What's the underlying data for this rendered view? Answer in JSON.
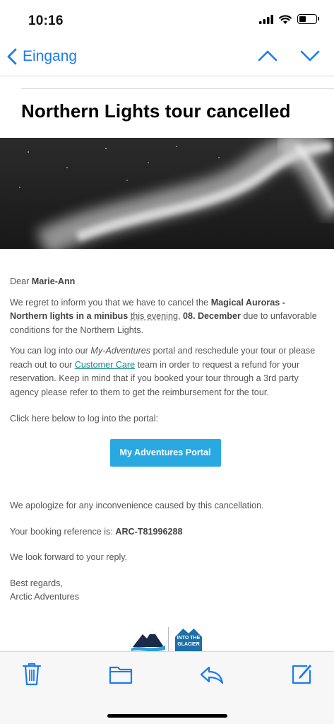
{
  "status_bar": {
    "time": "10:16"
  },
  "nav": {
    "back_label": "Eingang"
  },
  "email": {
    "subject": "Northern Lights tour cancelled",
    "greeting_prefix": "Dear ",
    "recipient_name": "Marie-Ann",
    "p1_a": "We regret to inform you that we have to cancel the ",
    "p1_tour": "Magical Auroras - Northern lights in a minibus",
    "p1_b": " ",
    "p1_when": "this evening",
    "p1_c": ",  ",
    "p1_date": "08. December",
    "p1_d": " due to unfavorable conditions for the Northern Lights.",
    "p2_a": "You can log into our ",
    "p2_portal": "My-Adventures",
    "p2_b": " portal and reschedule your tour or please reach out to our ",
    "p2_link": "Customer Care",
    "p2_c": " team in order to request a refund for your reservation. Keep in mind that if you booked your tour through a 3rd party agency please refer to them to get the reimbursement for the tour.",
    "p3": "Click here below to log into the portal:",
    "cta_label": "My Adventures Portal",
    "p4": "We apologize for any inconvenience caused by this cancellation.",
    "ref_prefix": "Your booking reference is: ",
    "ref_code": "ARC-T81996288",
    "p6": "We look forward to your reply.",
    "closing": "Best regards,",
    "signature": "Arctic Adventures",
    "logo2_line1": "INTO THE",
    "logo2_line2": "GLACIER"
  },
  "toolbar": {
    "icons": [
      "trash-icon",
      "folder-icon",
      "reply-icon",
      "compose-icon"
    ]
  },
  "colors": {
    "accent": "#1a7cf2",
    "cta": "#29a9e1",
    "link": "#0b8a86"
  }
}
